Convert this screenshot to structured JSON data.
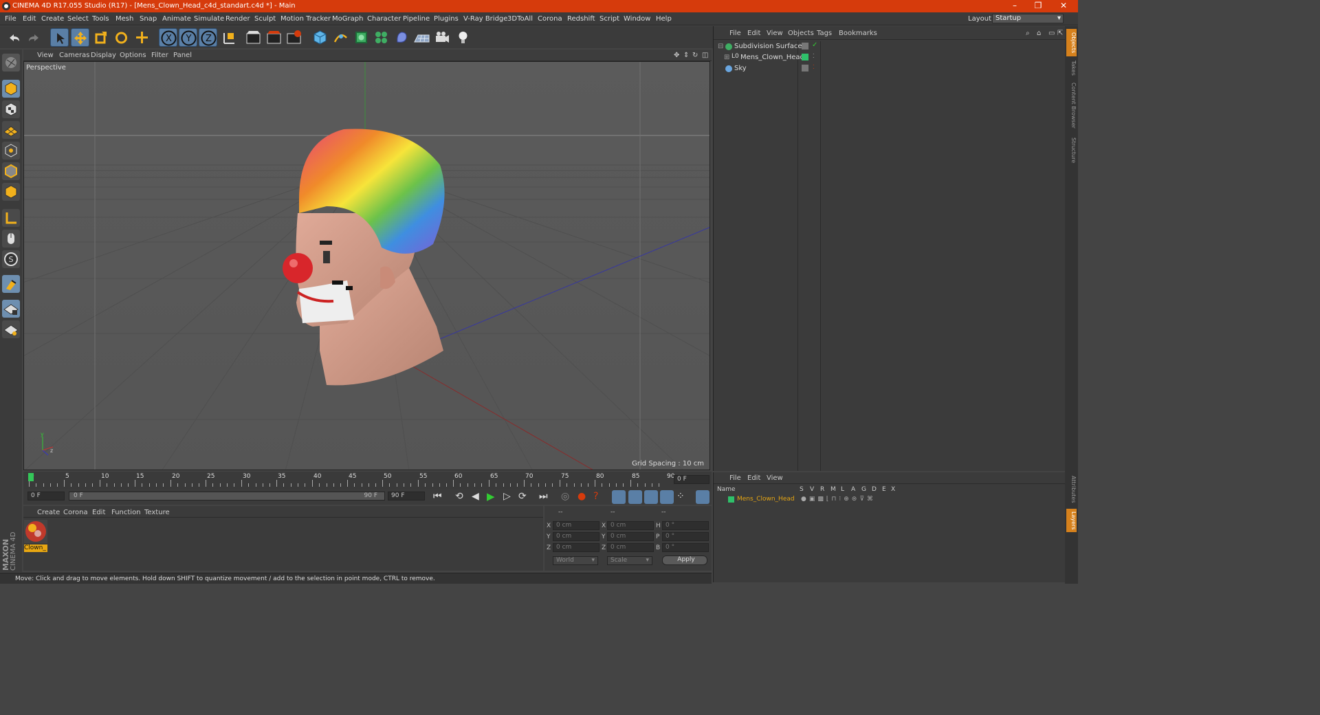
{
  "window": {
    "title": "CINEMA 4D R17.055 Studio (R17) - [Mens_Clown_Head_c4d_standart.c4d *] - Main",
    "controls": [
      "–",
      "❐",
      "✕"
    ]
  },
  "menubar": {
    "items": [
      "File",
      "Edit",
      "Create",
      "Select",
      "Tools",
      "Mesh",
      "Snap",
      "Animate",
      "Simulate",
      "Render",
      "Sculpt",
      "Motion Tracker",
      "MoGraph",
      "Character",
      "Pipeline",
      "Plugins",
      "V-Ray Bridge",
      "3DToAll",
      "Corona",
      "Redshift",
      "Script",
      "Window",
      "Help"
    ],
    "layout_label": "Layout:",
    "layout_value": "Startup"
  },
  "toolbar": {
    "axis_x": "X",
    "axis_y": "Y",
    "axis_z": "Z"
  },
  "viewport": {
    "menu": [
      "View",
      "Cameras",
      "Display",
      "Options",
      "Filter",
      "Panel"
    ],
    "label": "Perspective",
    "grid_spacing": "Grid Spacing : 10 cm"
  },
  "timeline": {
    "ticks": [
      "0",
      "5",
      "10",
      "15",
      "20",
      "25",
      "30",
      "35",
      "40",
      "45",
      "50",
      "55",
      "60",
      "65",
      "70",
      "75",
      "80",
      "85",
      "90"
    ],
    "current_frame": "0 F",
    "frame_end_box": "0 F"
  },
  "animation": {
    "start_field": "0 F",
    "range_start": "0 F",
    "range_end": "90 F",
    "end_field": "90 F"
  },
  "materials": {
    "menu": [
      "Create",
      "Corona",
      "Edit",
      "Function",
      "Texture"
    ],
    "items": [
      {
        "name": "Clown_"
      }
    ]
  },
  "coordinates": {
    "headers": [
      "--",
      "--",
      "--"
    ],
    "rows": [
      {
        "a": "X",
        "av": "0 cm",
        "b": "X",
        "bv": "0 cm",
        "c": "H",
        "cv": "0 °"
      },
      {
        "a": "Y",
        "av": "0 cm",
        "b": "Y",
        "bv": "0 cm",
        "c": "P",
        "cv": "0 °"
      },
      {
        "a": "Z",
        "av": "0 cm",
        "b": "Z",
        "bv": "0 cm",
        "c": "B",
        "cv": "0 °"
      }
    ],
    "mode": "World",
    "scale": "Scale",
    "apply": "Apply"
  },
  "objects_panel": {
    "menu": [
      "File",
      "Edit",
      "View",
      "Objects",
      "Tags",
      "Bookmarks"
    ],
    "items": [
      {
        "name": "Subdivision Surface",
        "color": "#dddddd"
      },
      {
        "name": "Mens_Clown_Head",
        "color": "#dddddd"
      },
      {
        "name": "Sky",
        "color": "#dddddd"
      }
    ]
  },
  "layers_panel": {
    "menu": [
      "File",
      "Edit",
      "View"
    ],
    "header_name": "Name",
    "columns": [
      "S",
      "V",
      "R",
      "M",
      "L",
      "A",
      "G",
      "D",
      "E",
      "X"
    ],
    "layer_name": "Mens_Clown_Head",
    "layer_color": "#e8a712"
  },
  "right_tabs": [
    "Objects",
    "Takes",
    "Content Browser",
    "Structure",
    "Attributes",
    "Layers"
  ],
  "maxon": {
    "line1": "MAXON",
    "line2": "CINEMA 4D"
  },
  "status": "Move: Click and drag to move elements. Hold down SHIFT to quantize movement / add to the selection in point mode, CTRL to remove.",
  "colors": {
    "accent": "#d63b0c",
    "selection": "#5a7fa6"
  }
}
